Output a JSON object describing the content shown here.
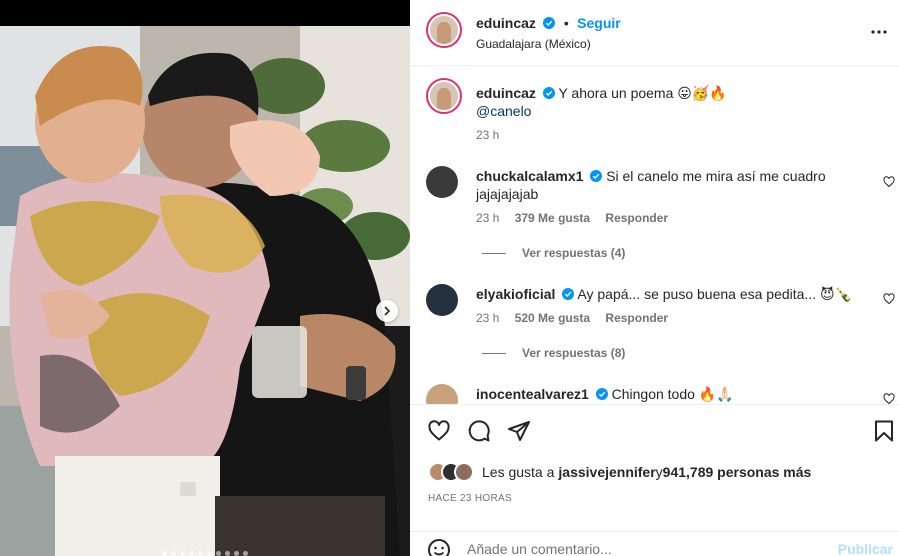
{
  "post": {
    "author": "eduincaz",
    "follow_label": "Seguir",
    "location": "Guadalajara (México)",
    "carousel": {
      "total": 10,
      "active": 0
    }
  },
  "caption": {
    "username": "eduincaz",
    "text": "Y ahora un poema 😛🥳🔥",
    "mention": "@canelo",
    "time": "23 h"
  },
  "comments": [
    {
      "username": "chuckalcalamx1",
      "text": "Si el canelo me mira así me cuadro jajajajajab",
      "time": "23 h",
      "likes": "379 Me gusta",
      "reply": "Responder",
      "view_replies": "Ver respuestas (4)"
    },
    {
      "username": "elyakioficial",
      "text": "Ay papá... se puso buena esa pedita... 😈🍾",
      "time": "23 h",
      "likes": "520 Me gusta",
      "reply": "Responder",
      "view_replies": "Ver respuestas (8)"
    },
    {
      "username": "inocentealvarez1",
      "text": "Chingon todo 🔥🙏🏻"
    }
  ],
  "likes": {
    "prefix": "Les gusta a ",
    "first_user": "jassivejennifer",
    "middle": " y ",
    "count": "941,789 personas más"
  },
  "timestamp": "HACE 23 HORAS",
  "add_comment": {
    "placeholder": "Añade un comentario...",
    "publish": "Publicar"
  },
  "colors": {
    "accent": "#0095f6",
    "verified": "#0095f6",
    "publish_disabled": "#b2dffc"
  }
}
